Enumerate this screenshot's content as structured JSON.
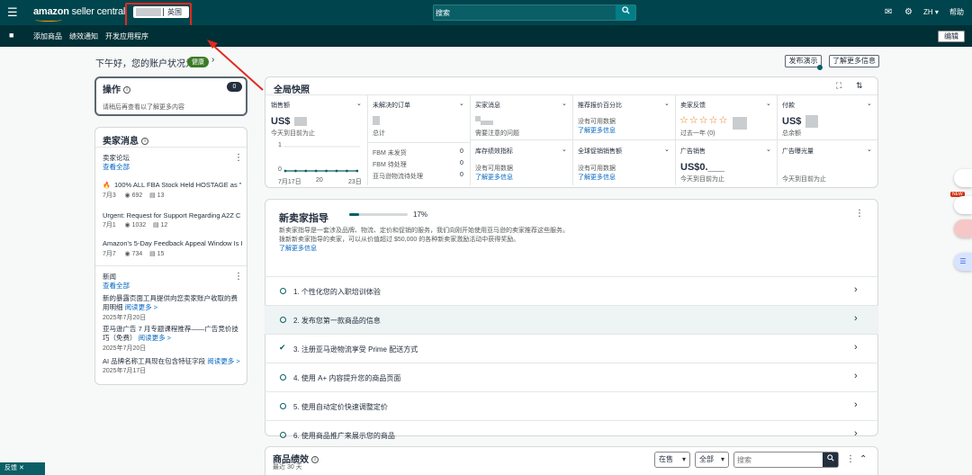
{
  "header": {
    "logo_text_bold": "amazon",
    "logo_text": " seller central",
    "marketplace": "英国",
    "search_placeholder": "搜索",
    "lang": "ZH",
    "help": "帮助"
  },
  "nav": {
    "items": [
      "添加商品",
      "绩效通知",
      "开发应用程序"
    ],
    "edit": "编辑"
  },
  "greeting": {
    "text": "下午好，您的账户状况为",
    "health": "健康",
    "publish_btn": "发布演示",
    "learn_more_btn": "了解更多信息"
  },
  "actions": {
    "title": "操作",
    "count": "0",
    "text": "请稍后再查看以了解更多内容"
  },
  "seller_news": {
    "title": "卖家消息",
    "forum_title": "卖家论坛",
    "view_all": "查看全部",
    "posts": [
      {
        "title": "100% ALL FBA Stock Held HOSTAGE as \"R",
        "date": "7月3",
        "views": "692",
        "comments": "13"
      },
      {
        "title": "Urgent: Request for Support Regarding A2Z C",
        "date": "7月1",
        "views": "1032",
        "comments": "12"
      },
      {
        "title": "Amazon's 5-Day Feedback Appeal Window Is I",
        "date": "7月7",
        "views": "734",
        "comments": "15"
      }
    ],
    "news_title": "新闻",
    "news_view_all": "查看全部",
    "news": [
      {
        "title_l1": "新的暴露页面工具提供向您卖家账户收取的费",
        "title_l2": "用明细",
        "read_more": "阅读更多 >",
        "date": "2025年7月20日"
      },
      {
        "title_l1": "亚马逊广告 7 月专题课程推荐——广告竞价技",
        "title_l2": "巧（免费）",
        "read_more": "阅读更多 >",
        "date": "2025年7月20日"
      },
      {
        "title_l1": "AI 品牌名称工具现在包含特征字段",
        "title_l2": "",
        "read_more": "阅读更多 >",
        "date": "2025年7月17日"
      }
    ]
  },
  "snapshot": {
    "title": "全局快照",
    "sales": {
      "label": "销售额",
      "value": "US$",
      "sub": "今天到目前为止",
      "y1": "1",
      "y0": "0",
      "x": [
        "7月17日",
        "20",
        "23日"
      ]
    },
    "open_orders": {
      "label": "未解决的订单",
      "sub": "总计",
      "rows": [
        {
          "k": "FBM 未发货",
          "v": "0"
        },
        {
          "k": "FBM 待处理",
          "v": "0"
        },
        {
          "k": "亚马逊物流待处理",
          "v": "0"
        }
      ]
    },
    "buyer_messages": {
      "label": "买家消息",
      "sub": "需要注意的问题"
    },
    "featured_offer": {
      "label": "推荐报价百分比",
      "sub": "没有可用数据",
      "link": "了解更多信息"
    },
    "feedback": {
      "label": "卖家反馈",
      "stars": "☆☆☆☆☆",
      "sub": "过去一年 (0)"
    },
    "payments": {
      "label": "付款",
      "value": "US$",
      "sub": "总余额"
    },
    "inventory": {
      "label": "库存绩效指标",
      "sub": "没有可用数据",
      "link": "了解更多信息"
    },
    "global_promo": {
      "label": "全球促销销售额",
      "sub": "没有可用数据",
      "link": "了解更多信息"
    },
    "ad_sales": {
      "label": "广告销售",
      "value": "US$0.___",
      "sub": "今天到目前为止"
    },
    "ad_impressions": {
      "label": "广告曝光量",
      "sub": "今天到目前为止"
    }
  },
  "guide": {
    "title": "新卖家指导",
    "progress": 17,
    "progress_label": "17%",
    "desc1": "新卖家指导是一套涉及品牌、物流、定价和促销的服务，我们向刚开始使用亚马逊的卖家推荐这些服务。",
    "desc2": "拨新新卖家指导的卖家，可以从价值超过 $50,000 的各种新卖家激励活动中获得奖励。",
    "link": "了解更多信息",
    "steps": [
      {
        "label": "1. 个性化您的入职培训体验",
        "done": false
      },
      {
        "label": "2. 发布您第一款商品的信息",
        "done": false
      },
      {
        "label": "3. 注册亚马逊物流享受 Prime 配送方式",
        "done": true
      },
      {
        "label": "4. 使用 A+ 内容提升您的商品页面",
        "done": false
      },
      {
        "label": "5. 使用自动定价快速调整定价",
        "done": false
      },
      {
        "label": "6. 使用商品推广来展示您的商品",
        "done": false
      }
    ]
  },
  "product_perf": {
    "title": "商品绩效",
    "sub": "最近 30 天",
    "status_select": "在售",
    "all_select": "全部",
    "search_placeholder": "搜索"
  },
  "side_tabs": {
    "new": "NEW"
  },
  "feedback_tab": "反馈"
}
